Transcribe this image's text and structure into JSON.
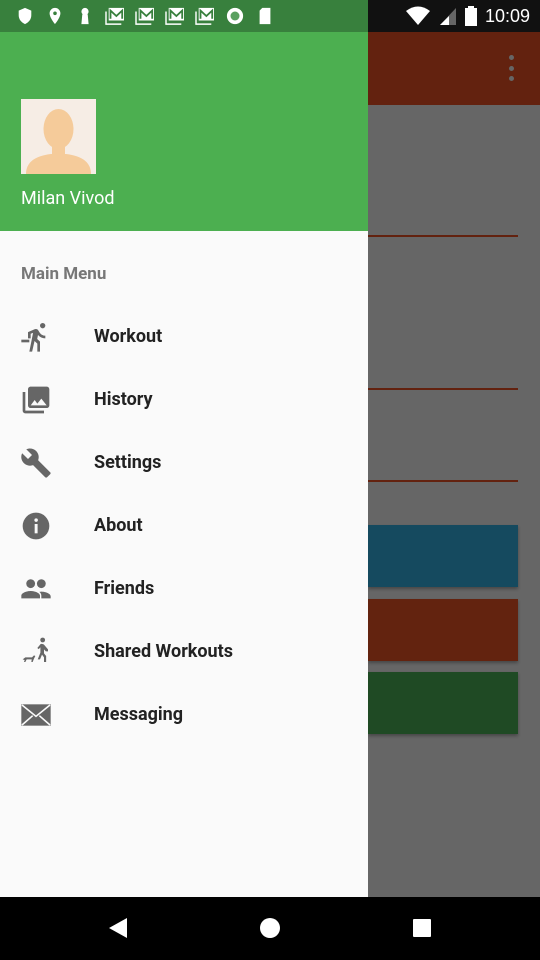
{
  "status_bar": {
    "time": "10:09",
    "icons": [
      "shield-icon",
      "location-icon",
      "keyhole-icon",
      "gmail-icon",
      "gmail-icon",
      "gmail-icon",
      "gmail-icon",
      "record-icon",
      "sd-card-icon"
    ]
  },
  "drawer": {
    "user_name": "Milan Vivod",
    "section_title": "Main Menu",
    "items": [
      {
        "label": "Workout",
        "icon": "running-icon"
      },
      {
        "label": "History",
        "icon": "photo-library-icon"
      },
      {
        "label": "Settings",
        "icon": "wrench-icon"
      },
      {
        "label": "About",
        "icon": "info-icon"
      },
      {
        "label": "Friends",
        "icon": "people-icon"
      },
      {
        "label": "Shared Workouts",
        "icon": "dog-walk-icon"
      },
      {
        "label": "Messaging",
        "icon": "envelope-icon"
      }
    ]
  },
  "colors": {
    "header": "#4caf50",
    "toolbar": "#63220f",
    "blue_button": "#154a5f",
    "brown_button": "#63230f",
    "green_button": "#1f4a24"
  }
}
